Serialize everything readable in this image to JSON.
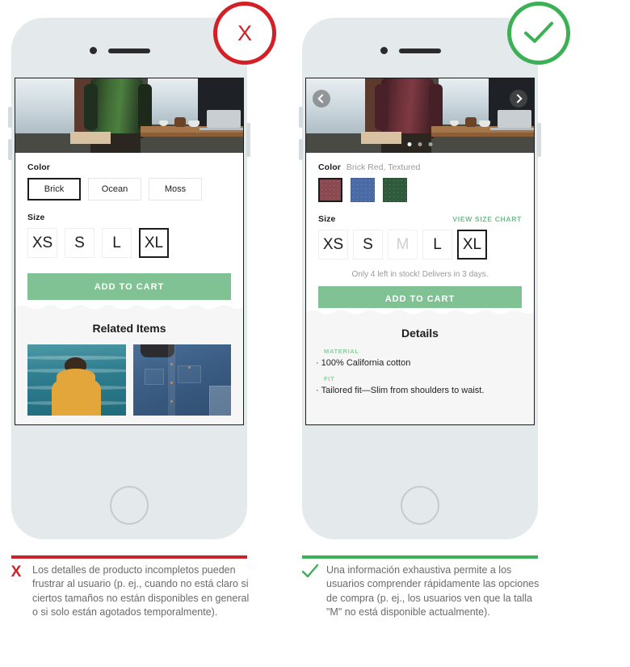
{
  "page": {
    "title": "Product detail page — incomplete vs. exhaustive information",
    "accent_green": "#81c295",
    "accent_green_dark": "#3cb054",
    "accent_red": "#cc2229"
  },
  "bad_example": {
    "badge": {
      "name": "x-badge",
      "glyph": "X",
      "color": "#d32027"
    },
    "screen": {
      "hero": {
        "alt": "Man in green shirt standing at a desk",
        "carousel": false
      },
      "color_section": {
        "label": "Color",
        "options": [
          {
            "label": "Brick",
            "selected": true
          },
          {
            "label": "Ocean",
            "selected": false
          },
          {
            "label": "Moss",
            "selected": false
          }
        ]
      },
      "size_section": {
        "label": "Size",
        "options": [
          {
            "label": "XS",
            "selected": false,
            "disabled": false
          },
          {
            "label": "S",
            "selected": false,
            "disabled": false
          },
          {
            "label": "L",
            "selected": false,
            "disabled": false
          },
          {
            "label": "XL",
            "selected": true,
            "disabled": false
          }
        ]
      },
      "cart_button": "ADD TO CART",
      "related": {
        "title": "Related Items",
        "items": [
          {
            "alt": "Man in yellow hooded jacket facing the sea"
          },
          {
            "alt": "Man wearing a blue denim shirt"
          }
        ]
      }
    },
    "caption": {
      "mark": "X",
      "text": "Los detalles de producto incompletos pueden frustrar al usuario (p. ej., cuando no está claro si ciertos tamaños no están disponibles en general o si solo están agotados temporalmente)."
    }
  },
  "good_example": {
    "badge": {
      "name": "check-badge",
      "glyph": "✓",
      "color": "#3cb054"
    },
    "screen": {
      "hero": {
        "alt": "Man in brick red shirt standing at a desk",
        "carousel": true,
        "prev_label": "Previous image",
        "next_label": "Next image",
        "dots": 3,
        "active_dot": 1
      },
      "color_section": {
        "label": "Color",
        "value": "Brick Red, Textured",
        "swatches": [
          {
            "name": "Brick Red, Textured",
            "hex": "#8b4a52",
            "selected": true
          },
          {
            "name": "Ocean Blue",
            "hex": "#4a6ba5",
            "selected": false
          },
          {
            "name": "Moss Green",
            "hex": "#2f5a3c",
            "selected": false
          }
        ]
      },
      "size_section": {
        "label": "Size",
        "size_chart_link": "VIEW SIZE CHART",
        "options": [
          {
            "label": "XS",
            "selected": false,
            "disabled": false
          },
          {
            "label": "S",
            "selected": false,
            "disabled": false
          },
          {
            "label": "M",
            "selected": false,
            "disabled": true
          },
          {
            "label": "L",
            "selected": false,
            "disabled": false
          },
          {
            "label": "XL",
            "selected": true,
            "disabled": false
          }
        ]
      },
      "stock_note": "Only 4 left in stock! Delivers in 3 days.",
      "cart_button": "ADD TO CART",
      "details": {
        "title": "Details",
        "groups": [
          {
            "category": "MATERIAL",
            "item": "100% California cotton"
          },
          {
            "category": "FIT",
            "item": "Tailored fit—Slim from shoulders to waist."
          }
        ],
        "bullet": "·"
      }
    },
    "caption": {
      "mark": "✓",
      "text": "Una información exhaustiva permite a los usuarios comprender rápidamente las opciones de compra (p. ej., los usuarios ven que la talla \"M\" no está disponible actualmente)."
    }
  }
}
